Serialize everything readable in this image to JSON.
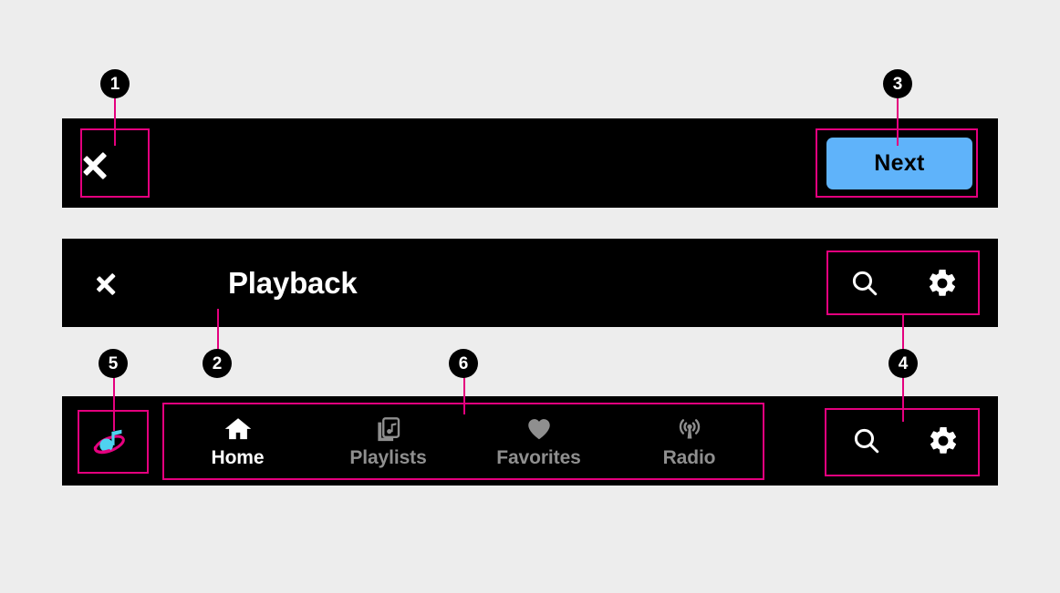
{
  "page": {
    "background_color": "#ededed",
    "bar_color": "#000000",
    "annotation_color": "#e4007e",
    "accent_color": "#5fb3fa",
    "active_text_color": "#ffffff",
    "inactive_text_color": "#8f8f8f"
  },
  "top_bar": {
    "back_icon": "chevron-left-icon",
    "next_label": "Next"
  },
  "playback_bar": {
    "back_icon": "chevron-left-icon",
    "title": "Playback",
    "actions": [
      {
        "icon": "search-icon",
        "name": "search-button"
      },
      {
        "icon": "gear-icon",
        "name": "settings-button"
      }
    ]
  },
  "bottom_bar": {
    "logo_icon": "music-note-orbit-logo",
    "tabs": [
      {
        "label": "Home",
        "icon": "home-icon",
        "active": true
      },
      {
        "label": "Playlists",
        "icon": "playlist-library-icon",
        "active": false
      },
      {
        "label": "Favorites",
        "icon": "heart-icon",
        "active": false
      },
      {
        "label": "Radio",
        "icon": "radio-broadcast-icon",
        "active": false
      }
    ],
    "actions": [
      {
        "icon": "search-icon",
        "name": "search-button"
      },
      {
        "icon": "gear-icon",
        "name": "settings-button"
      }
    ]
  },
  "annotations": {
    "badges": [
      {
        "number": "1",
        "target": "top-bar-back-button"
      },
      {
        "number": "2",
        "target": "playback-title"
      },
      {
        "number": "3",
        "target": "next-button"
      },
      {
        "number": "4",
        "target": "header-and-bottom-actions"
      },
      {
        "number": "5",
        "target": "app-logo"
      },
      {
        "number": "6",
        "target": "tab-group"
      }
    ]
  }
}
